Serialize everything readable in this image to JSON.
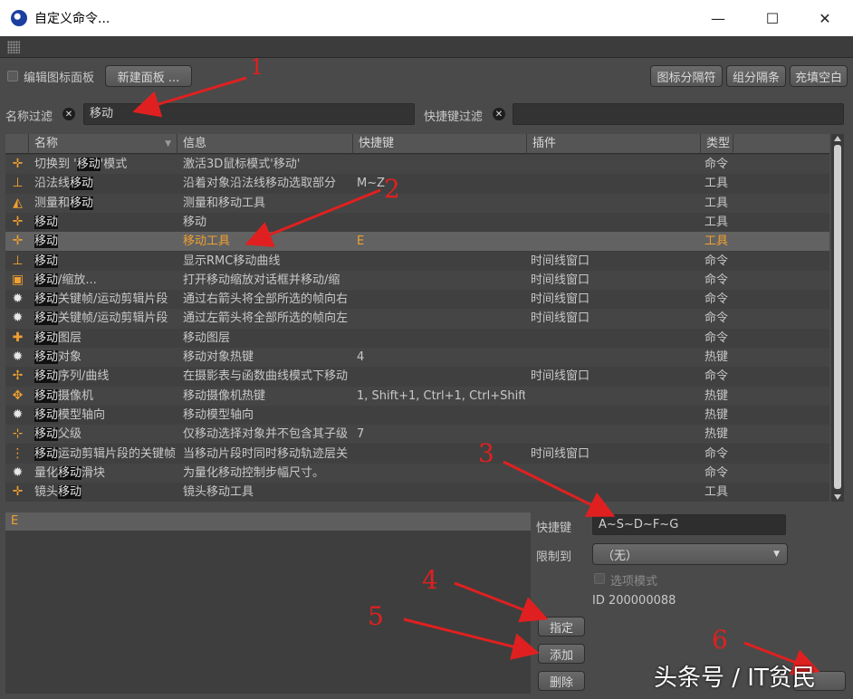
{
  "window": {
    "title": "自定义命令...",
    "minimize": "—",
    "maximize": "☐",
    "close": "✕"
  },
  "toolbar": {
    "edit_panel_label": "编辑图标面板",
    "new_panel_button": "新建面板 ...",
    "icon_separator_button": "图标分隔符",
    "group_separator_button": "组分隔条",
    "fill_space_button": "充填空白"
  },
  "filters": {
    "name_filter_label": "名称过滤",
    "name_filter_value": "移动",
    "shortcut_filter_label": "快捷键过滤",
    "shortcut_filter_value": ""
  },
  "table": {
    "columns": [
      "名称",
      "信息",
      "快捷键",
      "插件",
      "类型"
    ],
    "rows": [
      {
        "icon": "move-cross-icon",
        "glyph": "✛",
        "name_pre": "切换到 '",
        "name_hl": "移动",
        "name_post": "'模式",
        "info": "激活3D鼠标模式'移动'",
        "shortcut": "",
        "plugin": "",
        "type": "命令"
      },
      {
        "icon": "normal-move-icon",
        "glyph": "⊥",
        "name_pre": "沿法线",
        "name_hl": "移动",
        "name_post": "",
        "info": "沿着对象沿法线移动选取部分",
        "shortcut": "M~Z",
        "plugin": "",
        "type": "工具"
      },
      {
        "icon": "measure-icon",
        "glyph": "◭",
        "name_pre": "测量和",
        "name_hl": "移动",
        "name_post": "",
        "info": "测量和移动工具",
        "shortcut": "",
        "plugin": "",
        "type": "工具"
      },
      {
        "icon": "move-icon",
        "glyph": "✛",
        "name_pre": "",
        "name_hl": "移动",
        "name_post": "",
        "info": "移动",
        "shortcut": "",
        "plugin": "",
        "type": "工具"
      },
      {
        "icon": "move-tool-icon",
        "glyph": "✛",
        "name_pre": "",
        "name_hl": "移动",
        "name_post": "",
        "info": "移动工具",
        "shortcut": "E",
        "plugin": "",
        "type": "工具",
        "selected": true
      },
      {
        "icon": "rmc-move-icon",
        "glyph": "⊥",
        "name_pre": "",
        "name_hl": "移动",
        "name_post": "",
        "info": "显示RMC移动曲线",
        "shortcut": "",
        "plugin": "时间线窗口",
        "type": "命令"
      },
      {
        "icon": "move-scale-icon",
        "glyph": "▣",
        "name_pre": "",
        "name_hl": "移动",
        "name_post": "/缩放...",
        "info": "打开移动缩放对话框并移动/缩",
        "shortcut": "",
        "plugin": "时间线窗口",
        "type": "命令"
      },
      {
        "icon": "gear-icon",
        "glyph": "✹",
        "name_pre": "",
        "name_hl": "移动",
        "name_post": "关键帧/运动剪辑片段",
        "info": "通过右箭头将全部所选的帧向右",
        "shortcut": "",
        "plugin": "时间线窗口",
        "type": "命令"
      },
      {
        "icon": "gear-icon",
        "glyph": "✹",
        "name_pre": "",
        "name_hl": "移动",
        "name_post": "关键帧/运动剪辑片段",
        "info": "通过左箭头将全部所选的帧向左",
        "shortcut": "",
        "plugin": "时间线窗口",
        "type": "命令"
      },
      {
        "icon": "move-layer-icon",
        "glyph": "✚",
        "name_pre": "",
        "name_hl": "移动",
        "name_post": "图层",
        "info": "移动图层",
        "shortcut": "",
        "plugin": "",
        "type": "命令"
      },
      {
        "icon": "gear-icon",
        "glyph": "✹",
        "name_pre": "",
        "name_hl": "移动",
        "name_post": "对象",
        "info": "移动对象热键",
        "shortcut": "4",
        "plugin": "",
        "type": "热键"
      },
      {
        "icon": "sequence-curve-icon",
        "glyph": "✢",
        "name_pre": "",
        "name_hl": "移动",
        "name_post": "序列/曲线",
        "info": "在摄影表与函数曲线模式下移动",
        "shortcut": "",
        "plugin": "时间线窗口",
        "type": "命令"
      },
      {
        "icon": "camera-move-icon",
        "glyph": "✥",
        "name_pre": "",
        "name_hl": "移动",
        "name_post": "摄像机",
        "info": "移动摄像机热键",
        "shortcut": "1, Shift+1, Ctrl+1, Ctrl+Shift+",
        "plugin": "",
        "type": "热键"
      },
      {
        "icon": "gear-icon",
        "glyph": "✹",
        "name_pre": "",
        "name_hl": "移动",
        "name_post": "模型轴向",
        "info": "移动模型轴向",
        "shortcut": "",
        "plugin": "",
        "type": "热键"
      },
      {
        "icon": "parent-move-icon",
        "glyph": "⊹",
        "name_pre": "",
        "name_hl": "移动",
        "name_post": "父级",
        "info": "仅移动选择对象并不包含其子级",
        "shortcut": "7",
        "plugin": "",
        "type": "热键"
      },
      {
        "icon": "clip-keys-icon",
        "glyph": "⋮",
        "name_pre": "",
        "name_hl": "移动",
        "name_post": "运动剪辑片段的关键帧",
        "info": "当移动片段时同时移动轨迹层关",
        "shortcut": "",
        "plugin": "时间线窗口",
        "type": "命令"
      },
      {
        "icon": "gear-icon",
        "glyph": "✹",
        "name_pre": "量化",
        "name_hl": "移动",
        "name_post": "滑块",
        "info": "为量化移动控制步幅尺寸。",
        "shortcut": "",
        "plugin": "",
        "type": "命令"
      },
      {
        "icon": "lens-move-icon",
        "glyph": "✛",
        "name_pre": "镜头",
        "name_hl": "移动",
        "name_post": "",
        "info": "镜头移动工具",
        "shortcut": "",
        "plugin": "",
        "type": "工具"
      }
    ]
  },
  "detail": {
    "assigned_shortcut": "E",
    "shortcut_label": "快捷键",
    "shortcut_value": "A~S~D~F~G",
    "restrict_label": "限制到",
    "restrict_value": "（无）",
    "option_mode_label": "选项模式",
    "id_text": "ID 200000088",
    "assign_button": "指定",
    "add_button": "添加",
    "delete_button": "删除"
  },
  "annotations": [
    "1",
    "2",
    "3",
    "4",
    "5",
    "6"
  ],
  "watermark": "头条号 / IT贫民",
  "colors": {
    "highlight": "#f0a030",
    "annotation": "#e02020"
  }
}
